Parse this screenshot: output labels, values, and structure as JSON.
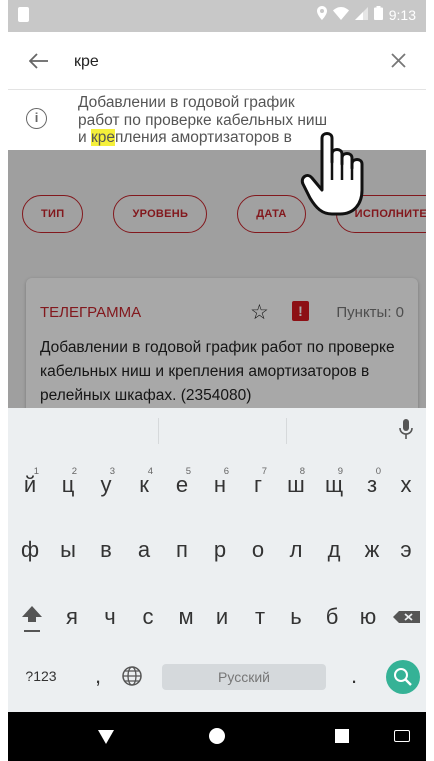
{
  "status_bar": {
    "time": "9:13",
    "icons": [
      "location-icon",
      "wifi-icon",
      "signal-icon",
      "battery-icon"
    ]
  },
  "search": {
    "query": "кре",
    "back_icon": "arrow-left-icon",
    "clear_icon": "close-icon",
    "suggestion": {
      "icon": "info-icon",
      "line1": "Добавлении в годовой график",
      "line2": "работ по проверке кабельных ниш",
      "line3_before": "и ",
      "line3_highlight": "кре",
      "line3_after": "пления амортизаторов в"
    }
  },
  "filters": [
    {
      "label": "ТИП"
    },
    {
      "label": "УРОВЕНЬ"
    },
    {
      "label": "ДАТА"
    },
    {
      "label": "ИСПОЛНИТЕ"
    }
  ],
  "card": {
    "type": "ТЕЛЕГРАММА",
    "star_icon": "star-outline-icon",
    "badge_icon": "alert-badge-icon",
    "badge_text": "!",
    "points": "Пункты: 0",
    "text": "Добавлении в годовой график работ по проверке кабельных ниш и крепления амортизаторов в релейных шкафах. (2354080)"
  },
  "keyboard": {
    "row1": [
      {
        "key": "й",
        "hint": "1"
      },
      {
        "key": "ц",
        "hint": "2"
      },
      {
        "key": "у",
        "hint": "3"
      },
      {
        "key": "к",
        "hint": "4"
      },
      {
        "key": "е",
        "hint": "5"
      },
      {
        "key": "н",
        "hint": "6"
      },
      {
        "key": "г",
        "hint": "7"
      },
      {
        "key": "ш",
        "hint": "8"
      },
      {
        "key": "щ",
        "hint": "9"
      },
      {
        "key": "з",
        "hint": "0"
      },
      {
        "key": "х",
        "hint": ""
      }
    ],
    "row2": [
      "ф",
      "ы",
      "в",
      "а",
      "п",
      "р",
      "о",
      "л",
      "д",
      "ж",
      "э"
    ],
    "row3": [
      "я",
      "ч",
      "с",
      "м",
      "и",
      "т",
      "ь",
      "б",
      "ю"
    ],
    "symbols_label": "?123",
    "comma": ",",
    "space_label": "Русский",
    "period": ".",
    "colors": {
      "action_key": "#35b296"
    }
  },
  "nav": {
    "icons": [
      "nav-back-icon",
      "nav-home-icon",
      "nav-recents-icon",
      "keyboard-switch-icon"
    ]
  },
  "colors": {
    "accent": "#c6252c",
    "badge": "#d71920",
    "highlight": "#f5f03a"
  }
}
